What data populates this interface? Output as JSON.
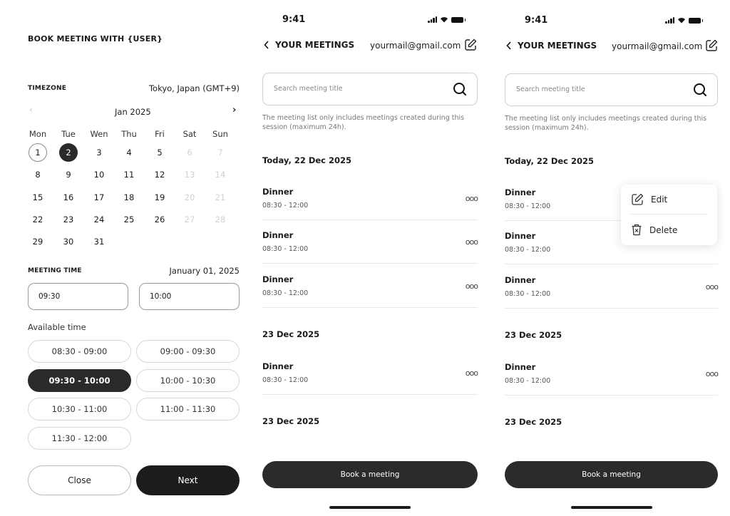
{
  "booking": {
    "title": "BOOK MEETING WITH {USER}",
    "timezone_label": "TIMEZONE",
    "timezone_value": "Tokyo, Japan (GMT+9)",
    "calendar": {
      "prev": "‹",
      "next": "›",
      "month": "Jan 2025",
      "weekdays": [
        "Mon",
        "Tue",
        "Wen",
        "Thu",
        "Fri",
        "Sat",
        "Sun"
      ],
      "rows": [
        [
          "1",
          "2",
          "3",
          "4",
          "5",
          "6",
          "7"
        ],
        [
          "8",
          "9",
          "10",
          "11",
          "12",
          "13",
          "14"
        ],
        [
          "15",
          "16",
          "17",
          "18",
          "19",
          "20",
          "21"
        ],
        [
          "22",
          "23",
          "24",
          "25",
          "26",
          "27",
          "28"
        ],
        [
          "29",
          "30",
          "31"
        ]
      ],
      "today": "1",
      "selected": "2"
    },
    "meeting_time_label": "MEETING TIME",
    "meeting_date": "January 01, 2025",
    "start_time": "09:30",
    "end_time": "10:00",
    "available_label": "Available time",
    "slots": [
      "08:30 - 09:00",
      "09:00 - 09:30",
      "09:30 - 10:00",
      "10:00 - 10:30",
      "10:30 - 11:00",
      "11:00 - 11:30",
      "11:30 - 12:00"
    ],
    "selected_slot": "09:30 - 10:00",
    "close_label": "Close",
    "next_label": "Next"
  },
  "meetings": {
    "status_time": "9:41",
    "back_title": "YOUR MEETINGS",
    "email": "yourmail@gmail.com",
    "search_placeholder": "Search meeting title",
    "hint": "The meeting list only includes meetings created during this session (maximum 24h).",
    "groups": [
      {
        "date": "Today, 22 Dec 2025",
        "items": [
          {
            "title": "Dinner",
            "time": "08:30 - 12:00"
          },
          {
            "title": "Dinner",
            "time": "08:30 - 12:00"
          },
          {
            "title": "Dinner",
            "time": "08:30 - 12:00"
          }
        ]
      },
      {
        "date": "23 Dec 2025",
        "items": [
          {
            "title": "Dinner",
            "time": "08:30 - 12:00"
          }
        ]
      },
      {
        "date": "23 Dec 2025",
        "items": []
      }
    ],
    "more_label": "ooo",
    "book_label": "Book a meeting",
    "menu": {
      "edit": "Edit",
      "delete": "Delete"
    }
  }
}
